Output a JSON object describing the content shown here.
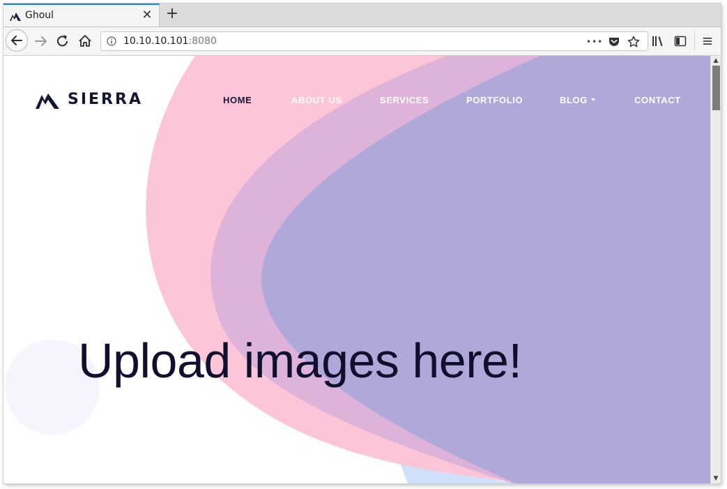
{
  "browser": {
    "tab_title": "Ghoul",
    "new_tab_symbol": "+",
    "close_symbol": "✕",
    "url_host": "10.10.10.101",
    "url_port": ":8080",
    "more_actions_symbol": "•••",
    "icons": [
      "back-icon",
      "forward-icon",
      "reload-icon",
      "home-icon",
      "info-icon",
      "pocket-icon",
      "bookmark-star-icon",
      "library-icon",
      "sidebar-icon",
      "menu-icon"
    ]
  },
  "site": {
    "logo_text": "SIERRA",
    "nav": {
      "home": "HOME",
      "about": "ABOUT US",
      "services": "SERVICES",
      "portfolio": "PORTFOLIO",
      "blog": "BLOG",
      "contact": "CONTACT"
    },
    "hero_title": "Upload images here!"
  },
  "colors": {
    "accent_tab": "#0a84ff",
    "dark_navy": "#141433",
    "blob_pink": "#fdc6d8",
    "blob_mauve": "#ddb3da",
    "blob_lavender": "#b1a8da",
    "blob_blue": "#cfe0fb"
  }
}
